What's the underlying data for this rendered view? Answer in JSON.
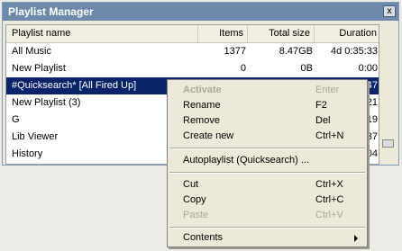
{
  "window": {
    "title": "Playlist Manager",
    "close_label": "x"
  },
  "columns": [
    "Playlist name",
    "Items",
    "Total size",
    "Duration"
  ],
  "rows": [
    {
      "name": "All Music",
      "items": "1377",
      "size": "8.47GB",
      "duration": "4d 0:35:33"
    },
    {
      "name": "New Playlist",
      "items": "0",
      "size": "0B",
      "duration": "0:00"
    },
    {
      "name": "#Quicksearch* [All Fired Up]",
      "items": "",
      "size": "",
      "duration": "47"
    },
    {
      "name": "New Playlist (3)",
      "items": "",
      "size": "",
      "duration": "21"
    },
    {
      "name": "G",
      "items": "",
      "size": "",
      "duration": "19"
    },
    {
      "name": "Lib Viewer",
      "items": "",
      "size": "",
      "duration": "37"
    },
    {
      "name": "History",
      "items": "",
      "size": "",
      "duration": "04"
    }
  ],
  "menu": {
    "activate": "Activate",
    "activate_sc": "Enter",
    "rename": "Rename",
    "rename_sc": "F2",
    "remove": "Remove",
    "remove_sc": "Del",
    "create_new": "Create new",
    "create_new_sc": "Ctrl+N",
    "autoplaylist": "Autoplaylist (Quicksearch) ...",
    "cut": "Cut",
    "cut_sc": "Ctrl+X",
    "copy": "Copy",
    "copy_sc": "Ctrl+C",
    "paste": "Paste",
    "paste_sc": "Ctrl+V",
    "contents": "Contents"
  }
}
